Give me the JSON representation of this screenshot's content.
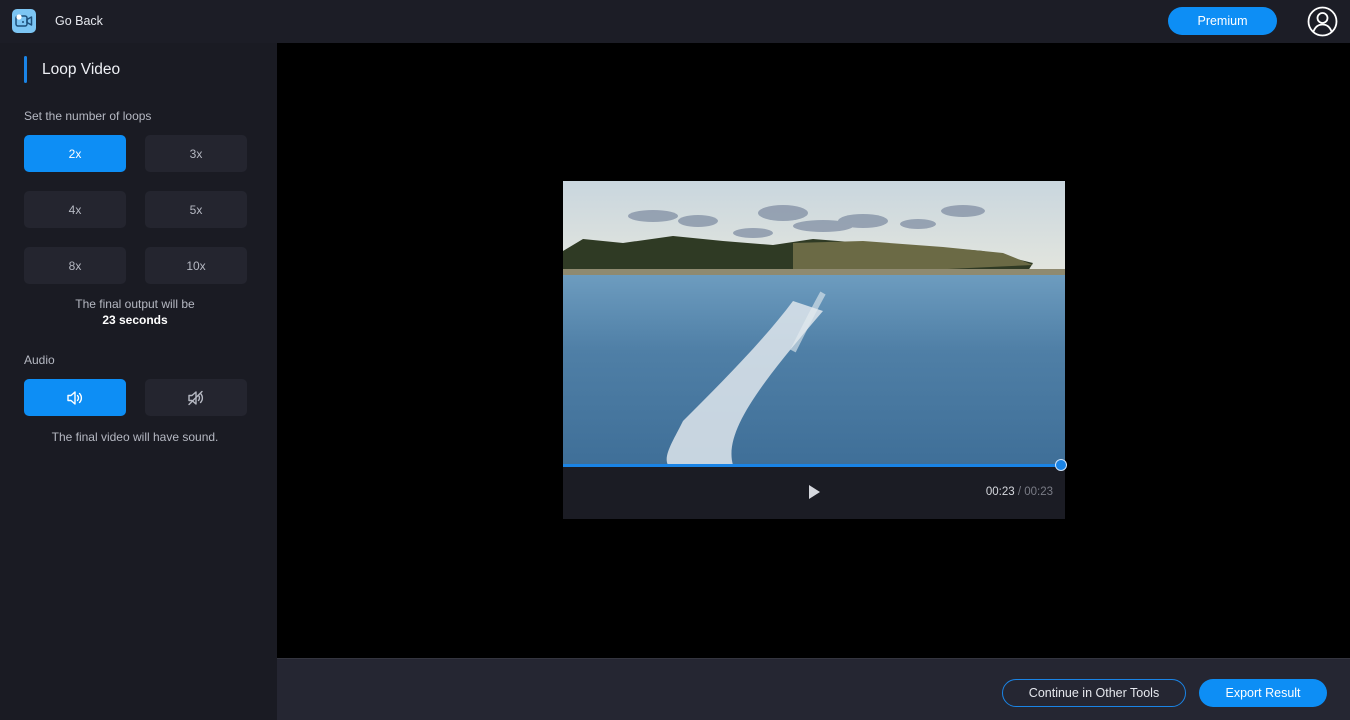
{
  "header": {
    "logo_icon": "video-editor-app-icon",
    "go_back_label": "Go Back",
    "premium_label": "Premium",
    "avatar_icon": "user-account-icon"
  },
  "sidebar": {
    "section_title": "Loop Video",
    "loops_label": "Set the number of loops",
    "loop_options": [
      {
        "label": "2x",
        "selected": true
      },
      {
        "label": "3x",
        "selected": false
      },
      {
        "label": "4x",
        "selected": false
      },
      {
        "label": "5x",
        "selected": false
      },
      {
        "label": "8x",
        "selected": false
      },
      {
        "label": "10x",
        "selected": false
      }
    ],
    "output_prefix": "The final output will be",
    "output_duration": "23 seconds",
    "audio_label": "Audio",
    "audio_options": [
      {
        "icon": "speaker-on-icon",
        "selected": true
      },
      {
        "icon": "speaker-muted-icon",
        "selected": false
      }
    ],
    "audio_info": "The final video will have sound."
  },
  "player": {
    "play_icon": "play-icon",
    "current_time": "00:23",
    "separator": " / ",
    "total_time": "00:23",
    "progress_percent": 100
  },
  "footer": {
    "continue_label": "Continue in Other Tools",
    "export_label": "Export Result"
  },
  "colors": {
    "accent": "#0d8ef5",
    "sidebar_bg": "#1a1b23",
    "topbar_bg": "#1c1d26",
    "button_bg": "#24252f"
  }
}
